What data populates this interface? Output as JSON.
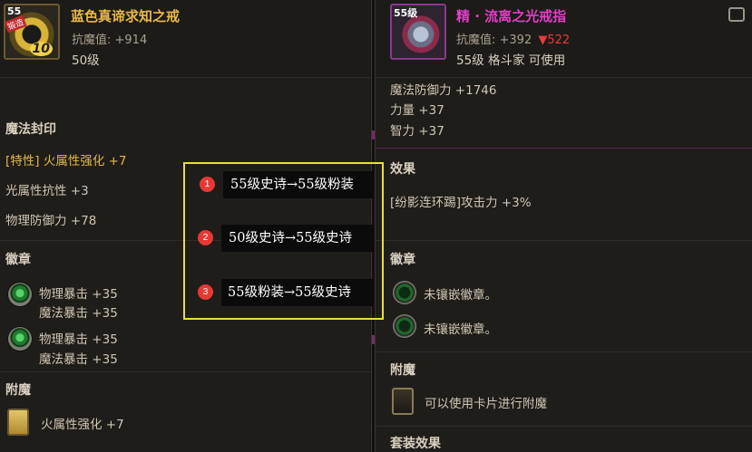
{
  "left": {
    "icon_badge_top": "55",
    "icon_badge_tag": "锻造",
    "icon_badge_num": "10",
    "title": "蓝色真谛求知之戒",
    "resist": "抗魔值: +914",
    "level": "50级",
    "sections": {
      "seal_title": "魔法封印",
      "seal_1": "[特性] 火属性强化 +7",
      "seal_2": "光属性抗性 +3",
      "seal_3": "物理防御力 +78",
      "emblem_title": "徽章",
      "emblem_1a": "物理暴击 +35",
      "emblem_1b": "魔法暴击 +35",
      "emblem_2a": "物理暴击 +35",
      "emblem_2b": "魔法暴击 +35",
      "enchant_title": "附魔",
      "enchant_1": "火属性强化 +7"
    }
  },
  "right": {
    "icon_badge_top": "55级",
    "title": "精 · 流离之光戒指",
    "resist": "抗魔值: +392",
    "resist_delta": "▼522",
    "level": "55级 格斗家 可使用",
    "stat_1": "魔法防御力 +1746",
    "stat_2": "力量 +37",
    "stat_3": "智力 +37",
    "effect_title": "效果",
    "effect_1": "[纷影连环踢]攻击力 +3%",
    "emblem_title": "徽章",
    "emblem_1": "未镶嵌徽章。",
    "emblem_2": "未镶嵌徽章。",
    "enchant_title": "附魔",
    "enchant_1": "可以使用卡片进行附魔",
    "set_title": "套装效果"
  },
  "overlay": {
    "items": [
      {
        "num": "1",
        "text": "55级史诗→55级粉装"
      },
      {
        "num": "2",
        "text": "50级史诗→55级史诗"
      },
      {
        "num": "3",
        "text": "55级粉装→55级史诗"
      }
    ]
  },
  "colors": {
    "left_title": "#e9b84a",
    "right_title": "#e23ec8",
    "delta_red": "#e83b3b",
    "overlay_border": "#e9de3a",
    "badge_red": "#e53935"
  }
}
